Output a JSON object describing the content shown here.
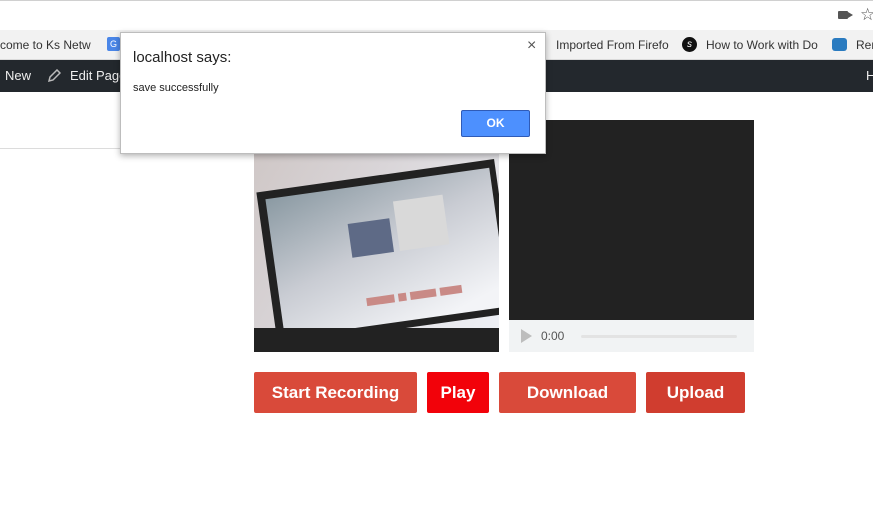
{
  "bookmarks": {
    "items": [
      {
        "label": "come to Ks Netw"
      },
      {
        "label": "Imported From Firefo"
      },
      {
        "label": "How to Work with Do"
      },
      {
        "label": "Rer"
      }
    ]
  },
  "adminbar": {
    "new_label": "New",
    "edit_label": "Edit Page",
    "right_label": "H"
  },
  "dialog": {
    "title": "localhost says:",
    "message": "save successfully",
    "ok_label": "OK",
    "close_glyph": "×"
  },
  "audio": {
    "time": "0:00"
  },
  "buttons": {
    "start": "Start Recording",
    "play": "Play",
    "download": "Download",
    "upload": "Upload"
  },
  "colors": {
    "admin_bar": "#23282d",
    "button_red": "#d94a3a",
    "play_red": "#f2020a",
    "dialog_ok": "#4d90fe"
  }
}
